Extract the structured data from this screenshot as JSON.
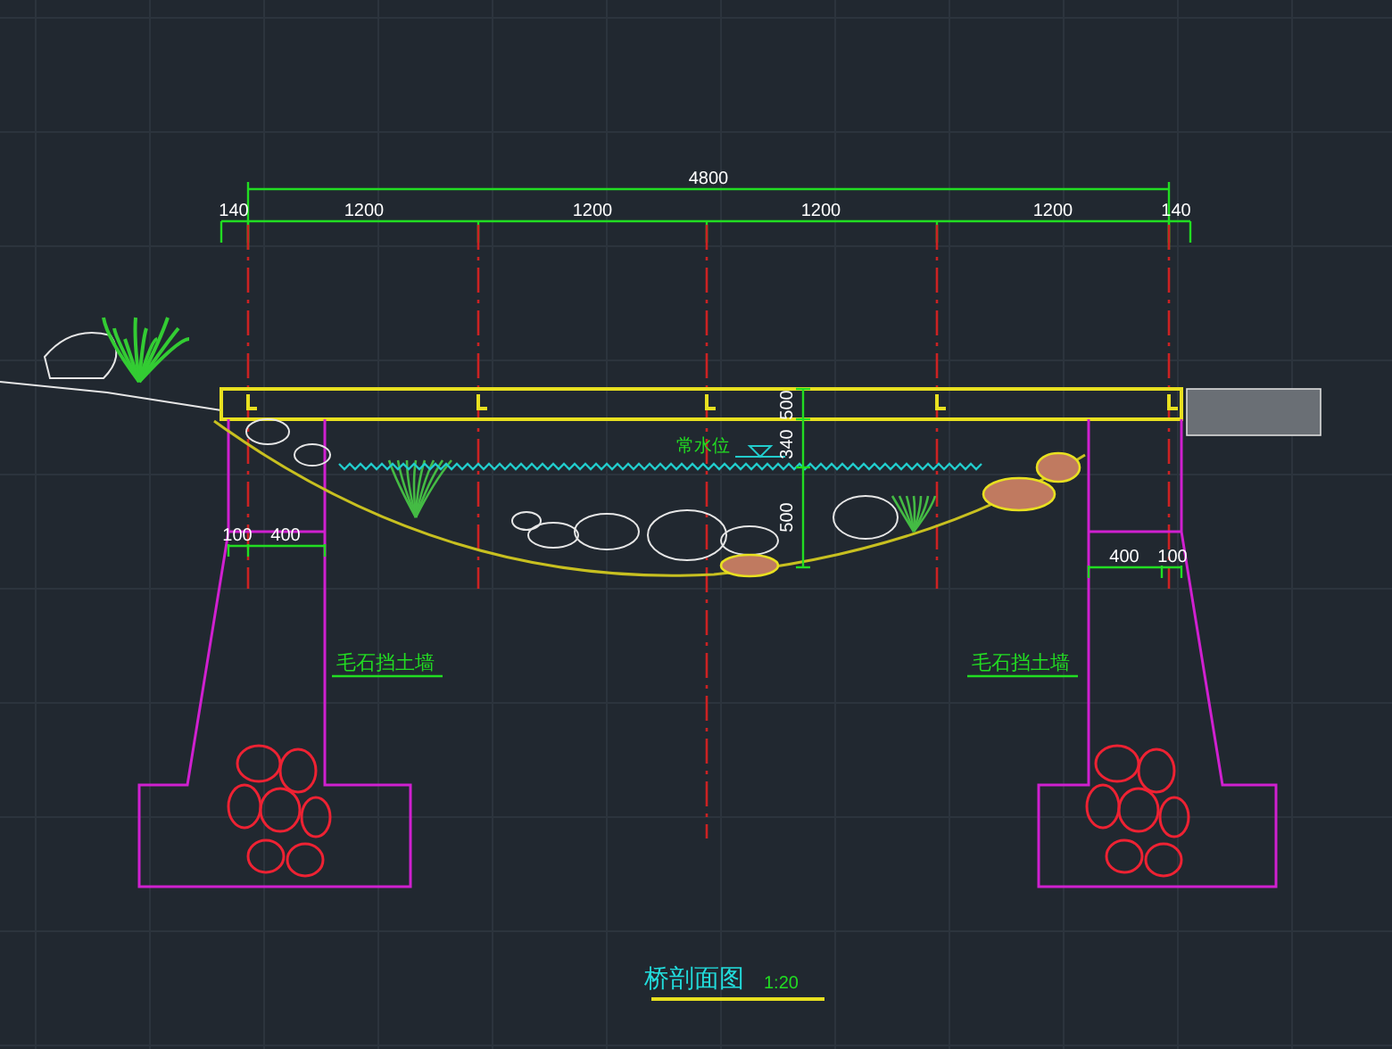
{
  "overall_dimension": "4800",
  "span_dimensions": [
    "140",
    "1200",
    "1200",
    "1200",
    "1200",
    "140"
  ],
  "vertical_dimensions": [
    "500",
    "340",
    "500"
  ],
  "water_level_label": "常水位",
  "left_abutment_dimensions": [
    "100",
    "400"
  ],
  "right_abutment_dimensions": [
    "400",
    "100"
  ],
  "wall_labels": [
    "毛石挡土墙",
    "毛石挡土墙"
  ],
  "drawing_title": "桥剖面图",
  "scale": "1:20"
}
